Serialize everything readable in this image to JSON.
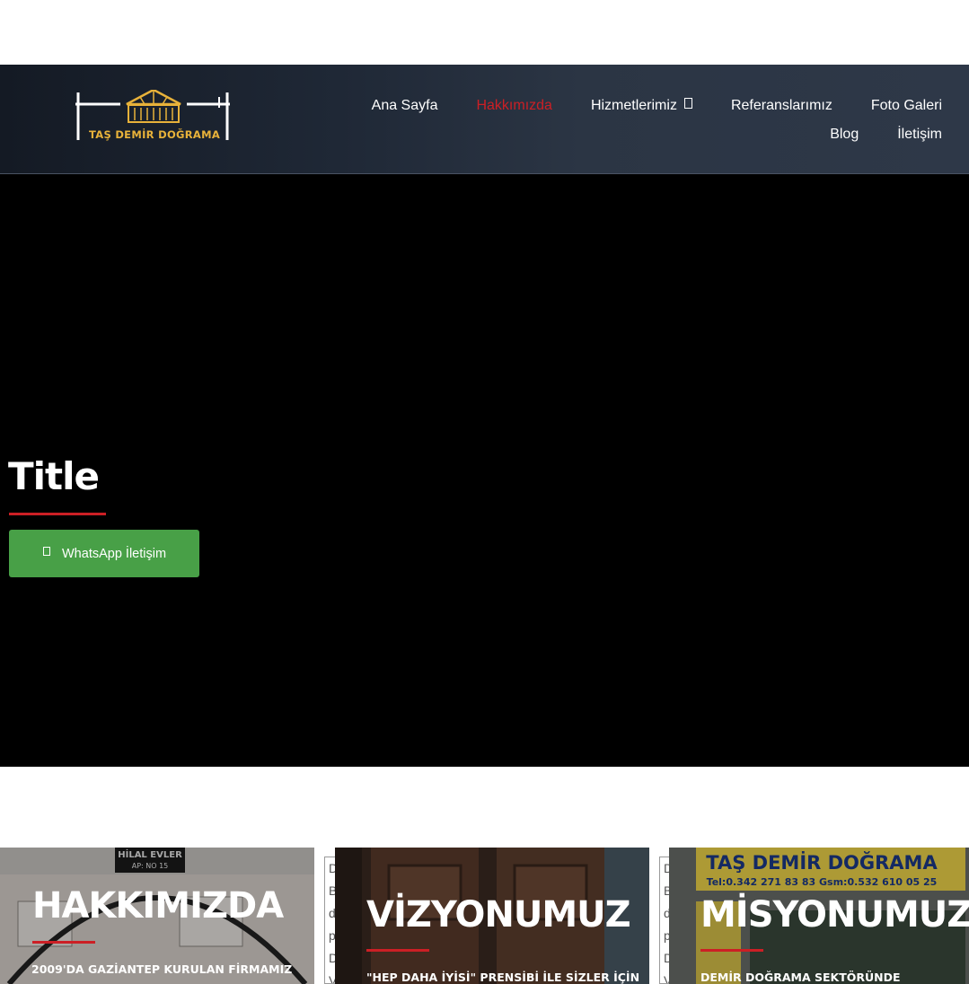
{
  "brand": {
    "logo_text": "TAŞ DEMİR DOĞRAMA"
  },
  "nav": {
    "row1": [
      {
        "label": "Ana Sayfa",
        "active": false
      },
      {
        "label": "Hakkımızda",
        "active": true
      },
      {
        "label": "Hizmetlerimiz",
        "active": false,
        "dropdown": true
      },
      {
        "label": "Referanslarımız",
        "active": false
      },
      {
        "label": "Foto Galeri",
        "active": false
      }
    ],
    "row2": [
      {
        "label": "Blog",
        "active": false
      },
      {
        "label": "İletişim",
        "active": false
      }
    ]
  },
  "hero": {
    "title": "Title",
    "button_label": "WhatsApp İletişim",
    "button_color": "#48a047",
    "accent_color": "#cc1f25"
  },
  "cards": [
    {
      "title": "HAKKIMIZDA",
      "subtitle": "2009'DA GAZİANTEP KURULAN FİRMAMIZ",
      "photo_text": [
        "HİLAL EVLER",
        "AP: NO 15"
      ]
    },
    {
      "title": "VİZYONUMUZ",
      "subtitle": "\"HEP DAHA İYİSİ\" PRENSİBİ İLE SİZLER İÇİN"
    },
    {
      "title": "MİSYONUMUZ",
      "subtitle": "DEMİR DOĞRAMA SEKTÖRÜNDE",
      "photo_text": [
        "TAŞ DEMİR DOĞRAMA",
        "Tel:0.342 271 83 83 Gsm:0.532 610 05 25"
      ]
    }
  ],
  "card_backs": [
    [
      "D",
      "B",
      "d",
      "p",
      "D",
      "V"
    ],
    [
      "D",
      "B",
      "d",
      "p",
      "D",
      "V"
    ]
  ]
}
